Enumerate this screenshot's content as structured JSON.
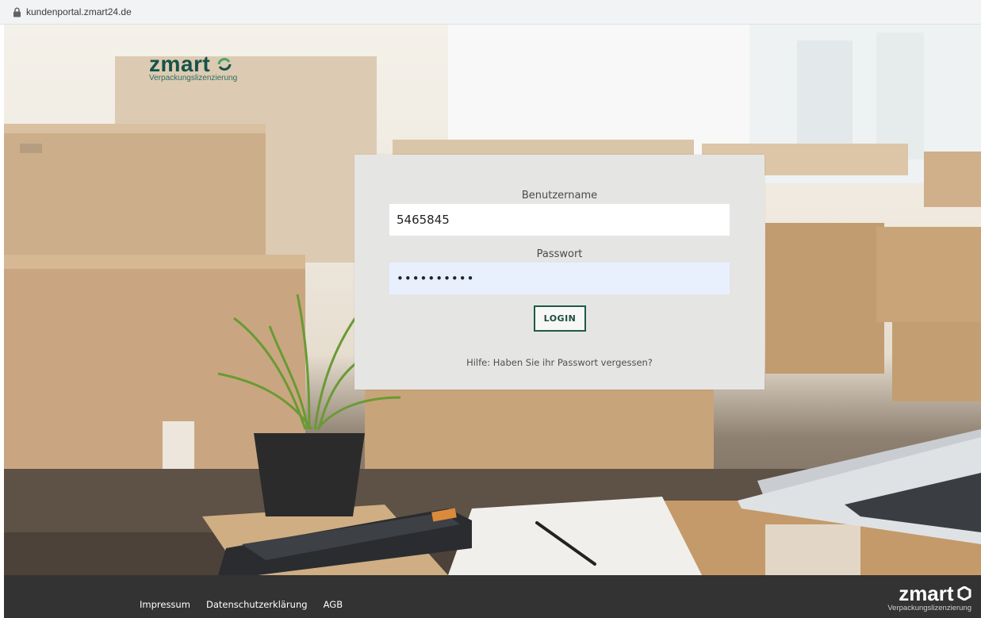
{
  "browser": {
    "url": "kundenportal.zmart24.de",
    "lock_icon": "lock-icon"
  },
  "header": {
    "logo_word": "zmart",
    "logo_tagline": "Verpackungslizenzierung"
  },
  "login": {
    "username_label": "Benutzername",
    "username_value": "5465845",
    "password_label": "Passwort",
    "password_value": "••••••••••",
    "login_button": "LOGIN",
    "forgot_link": "Hilfe: Haben Sie ihr Passwort vergessen?"
  },
  "footer": {
    "links": [
      "Impressum",
      "Datenschutzerklärung",
      "AGB"
    ],
    "logo_word": "zmart",
    "logo_tagline": "Verpackungslizenzierung"
  },
  "colors": {
    "brand_green": "#15534a",
    "panel_bg": "#e5e5e4",
    "footer_bg": "#333333",
    "autofill_bg": "#e8f0fe"
  }
}
